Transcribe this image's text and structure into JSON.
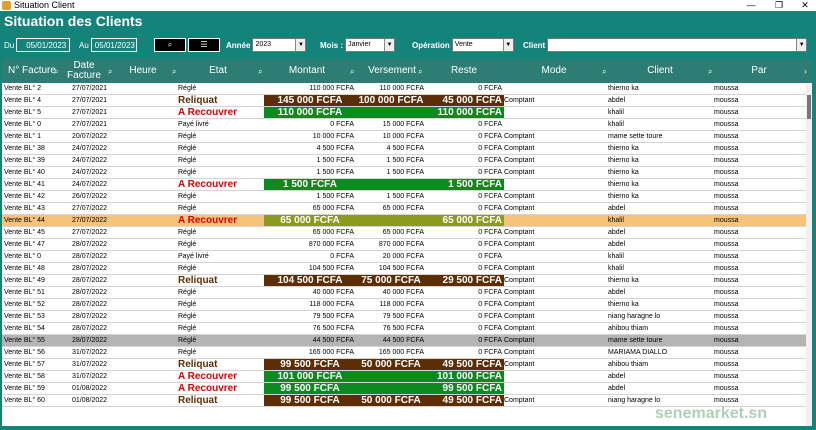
{
  "window": {
    "title": "Situation Client",
    "controls": [
      "—",
      "❐",
      "✕"
    ]
  },
  "app": {
    "heading": "Situation des Clients"
  },
  "filters": {
    "du_label": "Du",
    "du_value": "05/01/2023",
    "au_label": "Au",
    "au_value": "05/01/2023",
    "search_icon": "search-icon",
    "list_icon": "list-icon",
    "annee_label": "Année",
    "annee_value": "2023",
    "mois_label": "Mois :",
    "mois_value": "Janvier",
    "operation_label": "Opération",
    "operation_value": "Vente",
    "client_label": "Client",
    "client_value": ""
  },
  "columns": [
    {
      "label": "N° Facture",
      "sortable": true
    },
    {
      "label": "Date\nFacture",
      "sortable": true
    },
    {
      "label": "Heure",
      "sortable": true
    },
    {
      "label": "Etat",
      "sortable": true
    },
    {
      "label": "Montant",
      "sortable": true
    },
    {
      "label": "Versement",
      "sortable": true
    },
    {
      "label": "Reste",
      "sortable": false
    },
    {
      "label": "Mode",
      "sortable": true
    },
    {
      "label": "Client",
      "sortable": true
    },
    {
      "label": "Par",
      "sortable": false
    }
  ],
  "rows": [
    {
      "facture": "Vente BL° 2",
      "date": "27/07/2021",
      "heure": "",
      "etat": "Réglé",
      "montant": "110 000 FCFA",
      "versement": "110 000 FCFA",
      "reste": "0 FCFA",
      "mode": "",
      "client": "thierno ka",
      "par": "moussa",
      "style": "normal"
    },
    {
      "facture": "Vente BL° 4",
      "date": "27/07/2021",
      "heure": "",
      "etat": "Reliquat",
      "montant": "145 000 FCFA",
      "versement": "100 000 FCFA",
      "reste": "45 000 FCFA",
      "mode": "Comptant",
      "client": "abdel",
      "par": "moussa",
      "style": "reliquat"
    },
    {
      "facture": "Vente BL° 5",
      "date": "27/07/2021",
      "heure": "",
      "etat": "A Recouvrer",
      "montant": "110 000 FCFA",
      "versement": "",
      "reste": "110 000 FCFA",
      "mode": "",
      "client": "khalil",
      "par": "moussa",
      "style": "recouvrer"
    },
    {
      "facture": "Vente BL° 0",
      "date": "27/07/2021",
      "heure": "",
      "etat": "Payé livré",
      "montant": "0 FCFA",
      "versement": "15 000 FCFA",
      "reste": "0 FCFA",
      "mode": "",
      "client": "khalil",
      "par": "moussa",
      "style": "normal"
    },
    {
      "facture": "Vente BL° 1",
      "date": "20/07/2022",
      "heure": "",
      "etat": "Réglé",
      "montant": "10 000 FCFA",
      "versement": "10 000 FCFA",
      "reste": "0 FCFA",
      "mode": "Comptant",
      "client": "mame sette toure",
      "par": "moussa",
      "style": "normal"
    },
    {
      "facture": "Vente BL° 38",
      "date": "24/07/2022",
      "heure": "",
      "etat": "Réglé",
      "montant": "4 500 FCFA",
      "versement": "4 500 FCFA",
      "reste": "0 FCFA",
      "mode": "Comptant",
      "client": "thierno ka",
      "par": "moussa",
      "style": "normal"
    },
    {
      "facture": "Vente BL° 39",
      "date": "24/07/2022",
      "heure": "",
      "etat": "Réglé",
      "montant": "1 500 FCFA",
      "versement": "1 500 FCFA",
      "reste": "0 FCFA",
      "mode": "Comptant",
      "client": "thierno ka",
      "par": "moussa",
      "style": "normal"
    },
    {
      "facture": "Vente BL° 40",
      "date": "24/07/2022",
      "heure": "",
      "etat": "Réglé",
      "montant": "1 500 FCFA",
      "versement": "1 500 FCFA",
      "reste": "0 FCFA",
      "mode": "Comptant",
      "client": "thierno ka",
      "par": "moussa",
      "style": "normal"
    },
    {
      "facture": "Vente BL° 41",
      "date": "24/07/2022",
      "heure": "",
      "etat": "A Recouvrer",
      "montant": "1 500 FCFA",
      "versement": "",
      "reste": "1 500 FCFA",
      "mode": "",
      "client": "thierno ka",
      "par": "moussa",
      "style": "recouvrer"
    },
    {
      "facture": "Vente BL° 42",
      "date": "26/07/2022",
      "heure": "",
      "etat": "Réglé",
      "montant": "1 500 FCFA",
      "versement": "1 500 FCFA",
      "reste": "0 FCFA",
      "mode": "Comptant",
      "client": "thierno ka",
      "par": "moussa",
      "style": "normal"
    },
    {
      "facture": "Vente BL° 43",
      "date": "27/07/2022",
      "heure": "",
      "etat": "Réglé",
      "montant": "65 000 FCFA",
      "versement": "65 000 FCFA",
      "reste": "0 FCFA",
      "mode": "Comptant",
      "client": "abdel",
      "par": "moussa",
      "style": "normal"
    },
    {
      "facture": "Vente BL° 44",
      "date": "27/07/2022",
      "heure": "",
      "etat": "A Recouvrer",
      "montant": "65 000 FCFA",
      "versement": "",
      "reste": "65 000 FCFA",
      "mode": "",
      "client": "khalil",
      "par": "moussa",
      "style": "recouvrer-hl"
    },
    {
      "facture": "Vente BL° 45",
      "date": "27/07/2022",
      "heure": "",
      "etat": "Réglé",
      "montant": "65 000 FCFA",
      "versement": "65 000 FCFA",
      "reste": "0 FCFA",
      "mode": "Comptant",
      "client": "abdel",
      "par": "moussa",
      "style": "normal"
    },
    {
      "facture": "Vente BL° 47",
      "date": "28/07/2022",
      "heure": "",
      "etat": "Réglé",
      "montant": "870 000 FCFA",
      "versement": "870 000 FCFA",
      "reste": "0 FCFA",
      "mode": "Comptant",
      "client": "abdel",
      "par": "moussa",
      "style": "normal"
    },
    {
      "facture": "Vente BL° 0",
      "date": "28/07/2022",
      "heure": "",
      "etat": "Payé livré",
      "montant": "0 FCFA",
      "versement": "20 000 FCFA",
      "reste": "0 FCFA",
      "mode": "",
      "client": "khalil",
      "par": "moussa",
      "style": "normal"
    },
    {
      "facture": "Vente BL° 48",
      "date": "28/07/2022",
      "heure": "",
      "etat": "Réglé",
      "montant": "104 500 FCFA",
      "versement": "104 500 FCFA",
      "reste": "0 FCFA",
      "mode": "Comptant",
      "client": "khalil",
      "par": "moussa",
      "style": "normal"
    },
    {
      "facture": "Vente BL° 49",
      "date": "28/07/2022",
      "heure": "",
      "etat": "Reliquat",
      "montant": "104 500 FCFA",
      "versement": "75 000 FCFA",
      "reste": "29 500 FCFA",
      "mode": "Comptant",
      "client": "thierno ka",
      "par": "moussa",
      "style": "reliquat"
    },
    {
      "facture": "Vente BL° 51",
      "date": "28/07/2022",
      "heure": "",
      "etat": "Réglé",
      "montant": "40 000 FCFA",
      "versement": "40 000 FCFA",
      "reste": "0 FCFA",
      "mode": "Comptant",
      "client": "abdel",
      "par": "moussa",
      "style": "normal"
    },
    {
      "facture": "Vente BL° 52",
      "date": "28/07/2022",
      "heure": "",
      "etat": "Réglé",
      "montant": "118 000 FCFA",
      "versement": "118 000 FCFA",
      "reste": "0 FCFA",
      "mode": "Comptant",
      "client": "thierno ka",
      "par": "moussa",
      "style": "normal"
    },
    {
      "facture": "Vente BL° 53",
      "date": "28/07/2022",
      "heure": "",
      "etat": "Réglé",
      "montant": "79 500 FCFA",
      "versement": "79 500 FCFA",
      "reste": "0 FCFA",
      "mode": "Comptant",
      "client": "niang haragne lo",
      "par": "moussa",
      "style": "normal"
    },
    {
      "facture": "Vente BL° 54",
      "date": "28/07/2022",
      "heure": "",
      "etat": "Réglé",
      "montant": "76 500 FCFA",
      "versement": "76 500 FCFA",
      "reste": "0 FCFA",
      "mode": "Comptant",
      "client": "ahibou thiam",
      "par": "moussa",
      "style": "normal"
    },
    {
      "facture": "Vente BL° 55",
      "date": "28/07/2022",
      "heure": "",
      "etat": "Réglé",
      "montant": "44 500 FCFA",
      "versement": "44 500 FCFA",
      "reste": "0 FCFA",
      "mode": "Comptant",
      "client": "mame sette toure",
      "par": "moussa",
      "style": "gray"
    },
    {
      "facture": "Vente BL° 56",
      "date": "31/07/2022",
      "heure": "",
      "etat": "Réglé",
      "montant": "165 000 FCFA",
      "versement": "165 000 FCFA",
      "reste": "0 FCFA",
      "mode": "Comptant",
      "client": "MARIAMA DIALLO",
      "par": "moussa",
      "style": "normal"
    },
    {
      "facture": "Vente BL° 57",
      "date": "31/07/2022",
      "heure": "",
      "etat": "Reliquat",
      "montant": "99 500 FCFA",
      "versement": "50 000 FCFA",
      "reste": "49 500 FCFA",
      "mode": "Comptant",
      "client": "ahibou thiam",
      "par": "moussa",
      "style": "reliquat"
    },
    {
      "facture": "Vente BL° 58",
      "date": "31/07/2022",
      "heure": "",
      "etat": "A Recouvrer",
      "montant": "101 000 FCFA",
      "versement": "",
      "reste": "101 000 FCFA",
      "mode": "",
      "client": "abdel",
      "par": "moussa",
      "style": "recouvrer"
    },
    {
      "facture": "Vente BL° 59",
      "date": "01/08/2022",
      "heure": "",
      "etat": "A Recouvrer",
      "montant": "99 500 FCFA",
      "versement": "",
      "reste": "99 500 FCFA",
      "mode": "",
      "client": "abdel",
      "par": "moussa",
      "style": "recouvrer"
    },
    {
      "facture": "Vente BL° 60",
      "date": "01/08/2022",
      "heure": "",
      "etat": "Reliquat",
      "montant": "99 500 FCFA",
      "versement": "50 000 FCFA",
      "reste": "49 500 FCFA",
      "mode": "Comptant",
      "client": "niang haragne lo",
      "par": "moussa",
      "style": "reliquat"
    }
  ],
  "colors": {
    "teal": "#14837a",
    "header": "#2e7d75",
    "reliquat_band": "#5c2e06",
    "recouvrer_band": "#0b8a1f",
    "highlight_row": "#f5c37a",
    "highlight_band": "#8c9a1e",
    "reliquat_text": "#5c2e06",
    "recouvrer_text": "#e00000",
    "gray_row": "#b4b4b4"
  },
  "watermark": "senemarket.sn"
}
